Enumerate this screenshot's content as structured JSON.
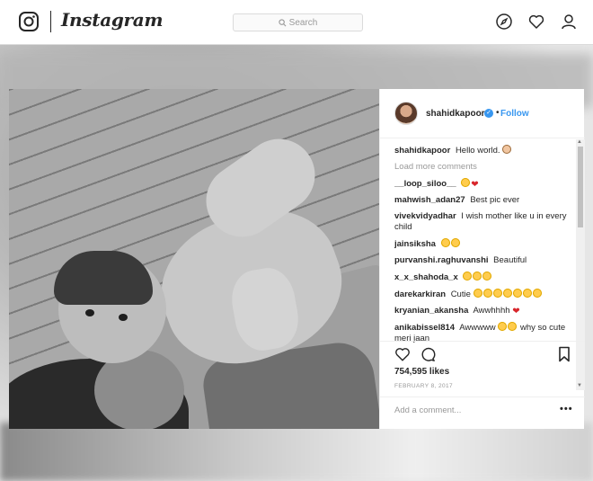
{
  "topbar": {
    "brand": "Instagram",
    "search_placeholder": "Search"
  },
  "post": {
    "username": "shahidkapoor",
    "follow_label": "Follow",
    "dot": "•",
    "caption": {
      "user": "shahidkapoor",
      "text": "Hello world."
    },
    "load_more": "Load more comments",
    "comments": [
      {
        "user": "__loop_siloo__",
        "text": ""
      },
      {
        "user": "mahwish_adan27",
        "text": "Best pic ever"
      },
      {
        "user": "vivekvidyadhar",
        "text": "I wish mother like u in every child"
      },
      {
        "user": "jainsiksha",
        "text": ""
      },
      {
        "user": "purvanshi.raghuvanshi",
        "text": "Beautiful"
      },
      {
        "user": "x_x_shahoda_x",
        "text": ""
      },
      {
        "user": "darekarkiran",
        "text": "Cutie"
      },
      {
        "user": "kryanian_akansha",
        "text": "Awwhhhh"
      },
      {
        "user": "anikabissel814",
        "text": "Awwwww",
        "text2": "why so cute meri jaan"
      }
    ],
    "likes": "754,595 likes",
    "date": "FEBRUARY 8, 2017",
    "add_comment_placeholder": "Add a comment...",
    "more_label": "•••"
  },
  "icons": {
    "logo": "instagram-camera-icon",
    "explore": "compass-icon",
    "activity": "heart-icon",
    "profile": "person-icon",
    "like": "heart-outline-icon",
    "comment": "speech-bubble-icon",
    "save": "bookmark-icon"
  },
  "colors": {
    "link_blue": "#3897f0",
    "border": "#dbdbdb",
    "muted_text": "#999999"
  }
}
